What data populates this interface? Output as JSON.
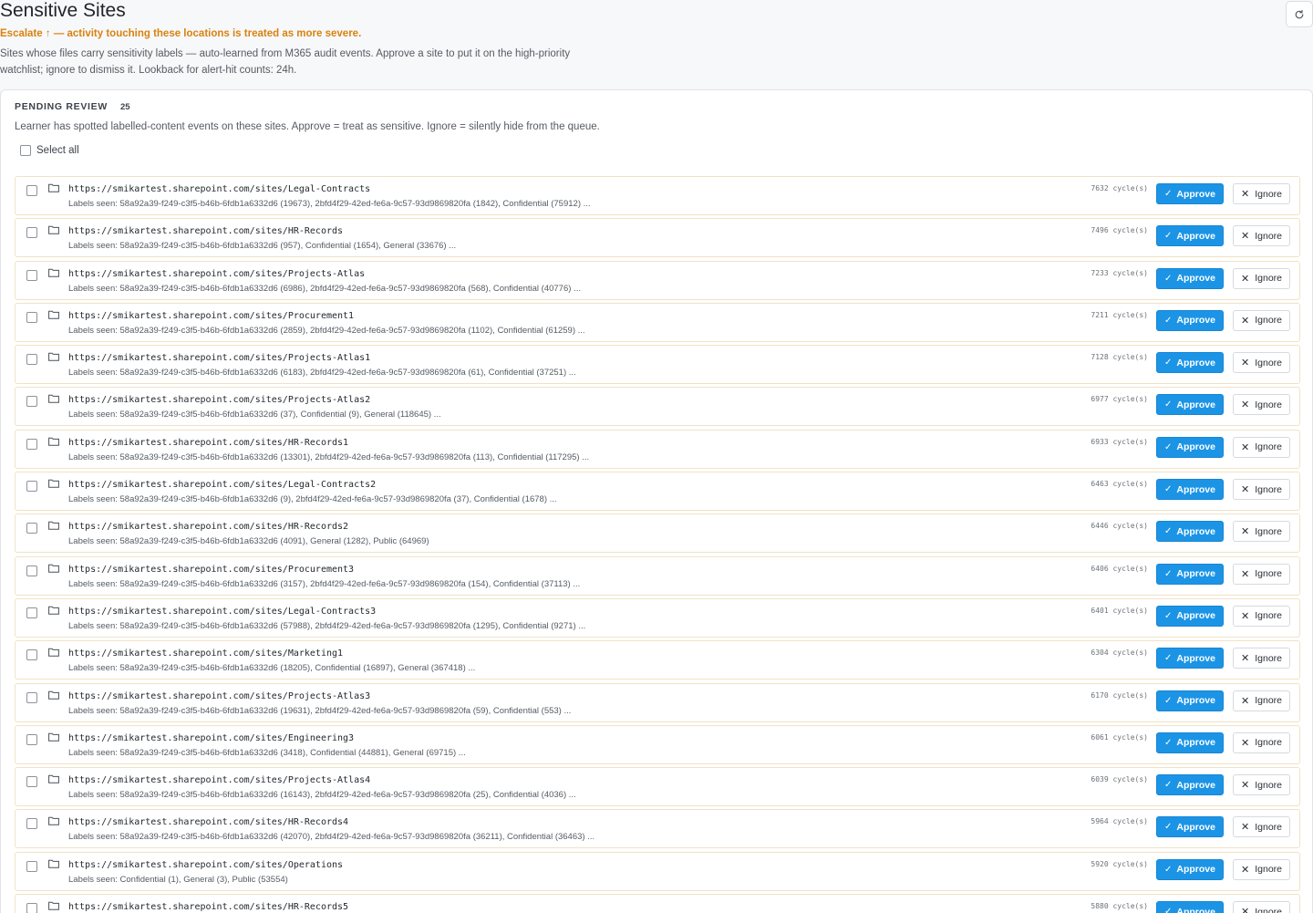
{
  "page": {
    "title": "Sensitive Sites",
    "escalate_note": "Escalate ↑ — activity touching these locations is treated as more severe.",
    "description": "Sites whose files carry sensitivity labels — auto-learned from M365 audit events. Approve a site to put it on the high-priority watchlist; ignore to dismiss it. Lookback for alert-hit counts: 24h.",
    "refresh_icon": "refresh-icon"
  },
  "pending": {
    "title": "PENDING REVIEW",
    "count": "25",
    "description": "Learner has spotted labelled-content events on these sites. Approve = treat as sensitive. Ignore = silently hide from the queue.",
    "select_all_label": "Select all"
  },
  "buttons": {
    "approve_label": "Approve",
    "ignore_label": "Ignore",
    "approve_icon": "✓",
    "ignore_icon": "✕"
  },
  "sites": [
    {
      "url": "https://smikartest.sharepoint.com/sites/Legal-Contracts",
      "labels": "Labels seen: 58a92a39-f249-c3f5-b46b-6fdb1a6332d6 (19673), 2bfd4f29-42ed-fe6a-9c57-93d9869820fa (1842), Confidential (75912) ...",
      "cycles": "7632 cycle(s)"
    },
    {
      "url": "https://smikartest.sharepoint.com/sites/HR-Records",
      "labels": "Labels seen: 58a92a39-f249-c3f5-b46b-6fdb1a6332d6 (957), Confidential (1654), General (33676) ...",
      "cycles": "7496 cycle(s)"
    },
    {
      "url": "https://smikartest.sharepoint.com/sites/Projects-Atlas",
      "labels": "Labels seen: 58a92a39-f249-c3f5-b46b-6fdb1a6332d6 (6986), 2bfd4f29-42ed-fe6a-9c57-93d9869820fa (568), Confidential (40776) ...",
      "cycles": "7233 cycle(s)"
    },
    {
      "url": "https://smikartest.sharepoint.com/sites/Procurement1",
      "labels": "Labels seen: 58a92a39-f249-c3f5-b46b-6fdb1a6332d6 (2859), 2bfd4f29-42ed-fe6a-9c57-93d9869820fa (1102), Confidential (61259) ...",
      "cycles": "7211 cycle(s)"
    },
    {
      "url": "https://smikartest.sharepoint.com/sites/Projects-Atlas1",
      "labels": "Labels seen: 58a92a39-f249-c3f5-b46b-6fdb1a6332d6 (6183), 2bfd4f29-42ed-fe6a-9c57-93d9869820fa (61), Confidential (37251) ...",
      "cycles": "7128 cycle(s)"
    },
    {
      "url": "https://smikartest.sharepoint.com/sites/Projects-Atlas2",
      "labels": "Labels seen: 58a92a39-f249-c3f5-b46b-6fdb1a6332d6 (37), Confidential (9), General (118645) ...",
      "cycles": "6977 cycle(s)"
    },
    {
      "url": "https://smikartest.sharepoint.com/sites/HR-Records1",
      "labels": "Labels seen: 58a92a39-f249-c3f5-b46b-6fdb1a6332d6 (13301), 2bfd4f29-42ed-fe6a-9c57-93d9869820fa (113), Confidential (117295) ...",
      "cycles": "6933 cycle(s)"
    },
    {
      "url": "https://smikartest.sharepoint.com/sites/Legal-Contracts2",
      "labels": "Labels seen: 58a92a39-f249-c3f5-b46b-6fdb1a6332d6 (9), 2bfd4f29-42ed-fe6a-9c57-93d9869820fa (37), Confidential (1678) ...",
      "cycles": "6463 cycle(s)"
    },
    {
      "url": "https://smikartest.sharepoint.com/sites/HR-Records2",
      "labels": "Labels seen: 58a92a39-f249-c3f5-b46b-6fdb1a6332d6 (4091), General (1282), Public (64969)",
      "cycles": "6446 cycle(s)"
    },
    {
      "url": "https://smikartest.sharepoint.com/sites/Procurement3",
      "labels": "Labels seen: 58a92a39-f249-c3f5-b46b-6fdb1a6332d6 (3157), 2bfd4f29-42ed-fe6a-9c57-93d9869820fa (154), Confidential (37113) ...",
      "cycles": "6406 cycle(s)"
    },
    {
      "url": "https://smikartest.sharepoint.com/sites/Legal-Contracts3",
      "labels": "Labels seen: 58a92a39-f249-c3f5-b46b-6fdb1a6332d6 (57988), 2bfd4f29-42ed-fe6a-9c57-93d9869820fa (1295), Confidential (9271) ...",
      "cycles": "6401 cycle(s)"
    },
    {
      "url": "https://smikartest.sharepoint.com/sites/Marketing1",
      "labels": "Labels seen: 58a92a39-f249-c3f5-b46b-6fdb1a6332d6 (18205), Confidential (16897), General (367418) ...",
      "cycles": "6304 cycle(s)"
    },
    {
      "url": "https://smikartest.sharepoint.com/sites/Projects-Atlas3",
      "labels": "Labels seen: 58a92a39-f249-c3f5-b46b-6fdb1a6332d6 (19631), 2bfd4f29-42ed-fe6a-9c57-93d9869820fa (59), Confidential (553) ...",
      "cycles": "6170 cycle(s)"
    },
    {
      "url": "https://smikartest.sharepoint.com/sites/Engineering3",
      "labels": "Labels seen: 58a92a39-f249-c3f5-b46b-6fdb1a6332d6 (3418), Confidential (44881), General (69715) ...",
      "cycles": "6061 cycle(s)"
    },
    {
      "url": "https://smikartest.sharepoint.com/sites/Projects-Atlas4",
      "labels": "Labels seen: 58a92a39-f249-c3f5-b46b-6fdb1a6332d6 (16143), 2bfd4f29-42ed-fe6a-9c57-93d9869820fa (25), Confidential (4036) ...",
      "cycles": "6039 cycle(s)"
    },
    {
      "url": "https://smikartest.sharepoint.com/sites/HR-Records4",
      "labels": "Labels seen: 58a92a39-f249-c3f5-b46b-6fdb1a6332d6 (42070), 2bfd4f29-42ed-fe6a-9c57-93d9869820fa (36211), Confidential (36463) ...",
      "cycles": "5964 cycle(s)"
    },
    {
      "url": "https://smikartest.sharepoint.com/sites/Operations",
      "labels": "Labels seen: Confidential (1), General (3), Public (53554)",
      "cycles": "5920 cycle(s)"
    },
    {
      "url": "https://smikartest.sharepoint.com/sites/HR-Records5",
      "labels": "",
      "cycles": "5880 cycle(s)"
    }
  ]
}
